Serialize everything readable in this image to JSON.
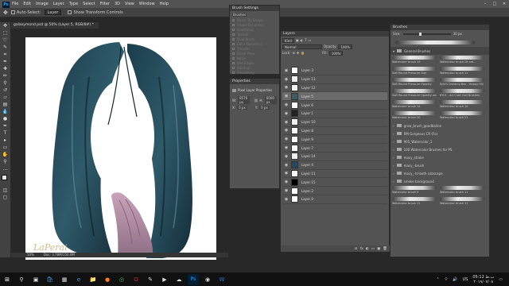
{
  "menubar": {
    "app_icon": "Ps",
    "items": [
      "File",
      "Edit",
      "Image",
      "Layer",
      "Type",
      "Select",
      "Filter",
      "3D",
      "View",
      "Window",
      "Help"
    ]
  },
  "window_controls": [
    "–",
    "□",
    "✕"
  ],
  "options_bar": {
    "auto_select": "Auto-Select:",
    "auto_select_target": "Layer",
    "show_transform": "Show Transform Controls"
  },
  "document": {
    "tab_title": "galaxymond.psd @ 50% (Layer 5, RGB/8#) *",
    "status": "50%",
    "doc_info": "Doc: 3.78M/150.0M",
    "signature": "LaPerai"
  },
  "brush_settings": {
    "title": "Brush Settings",
    "tab": "Brushes",
    "items": [
      "Brush Tip Shape",
      "Shape Dynamics",
      "Scattering",
      "Texture",
      "Dual Brush",
      "Color Dynamics",
      "Transfer",
      "Brush Pose",
      "Noise",
      "Wet Edges",
      "Build-up",
      "Smoothing"
    ]
  },
  "properties": {
    "title": "Properties",
    "subtitle": "Pixel Layer Properties",
    "w_label": "W:",
    "w_value": "8576 px",
    "h_label": "H:",
    "h_value": "6000 px",
    "x_label": "X:",
    "x_value": "0 px",
    "y_label": "Y:",
    "y_value": "0 px"
  },
  "layers": {
    "title": "Layers",
    "kind": "Kind",
    "mode": "Normal",
    "opacity_label": "Opacity:",
    "opacity": "100%",
    "lock_label": "Lock:",
    "fill_label": "Fill:",
    "fill": "100%",
    "items": [
      {
        "name": "Layer 3",
        "thumb": "#ffffff"
      },
      {
        "name": "Layer 13",
        "thumb": "#f0f0f0"
      },
      {
        "name": "Layer 12",
        "thumb": "#f3f3f3"
      },
      {
        "name": "Layer 5",
        "thumb": "#3d5d66",
        "selected": true
      },
      {
        "name": "Layer 6",
        "thumb": "#ffffff"
      },
      {
        "name": "Layer 1",
        "thumb": "#222222"
      },
      {
        "name": "Layer 10",
        "thumb": "#f2f2f2"
      },
      {
        "name": "Layer 8",
        "thumb": "#ffffff"
      },
      {
        "name": "Layer 9",
        "thumb": "#fafafa"
      },
      {
        "name": "Layer 7",
        "thumb": "#ffffff"
      },
      {
        "name": "Layer 14",
        "thumb": "#eeeeee"
      },
      {
        "name": "Layer 4",
        "thumb": "#1d4b66"
      },
      {
        "name": "Layer 11",
        "thumb": "#f5f5f5"
      },
      {
        "name": "Layer 15",
        "thumb": "#000000"
      },
      {
        "name": "Layer 2",
        "thumb": "#ffffff"
      },
      {
        "name": "Layer 0",
        "thumb": "#ffffff"
      }
    ],
    "footer_icons": [
      "⊘",
      "fx",
      "◐",
      "▭",
      "▣",
      "🗑"
    ]
  },
  "brushes": {
    "title": "Brushes",
    "size_label": "Size:",
    "size": "30 px",
    "group": "General Brushes",
    "grid": [
      [
        "Watercolor brush 19",
        "Watercolor brush 28 cat..."
      ],
      [
        "Soft Round Pressure Size",
        "Watercolor brush 11"
      ],
      [
        "Soft Round Pressure Opacity",
        "Kyle's Drawing Box - Happy Hill"
      ],
      [
        "Soft Round Pressure Opacity and Flow",
        "KYLE - Art Craft Gall Brushes"
      ],
      [
        "Watercolor brush 14",
        "Watercolor brush 10"
      ],
      [
        "Watercolor brush 20",
        "Watercolor brush 21"
      ]
    ],
    "folders": [
      "grow_brush_goodbaline",
      "RM Gorgeous CR (Fo)",
      "905_Watercolor_1",
      "100 Watercolor Brushes for PS",
      "macy_stroke",
      "macy_-brush",
      "macy_-hr-both cobscape",
      "smoke background"
    ],
    "bottom_grid": [
      [
        "Watercolor brush 9",
        "Watercolor brush 11"
      ],
      [
        "Watercolor brush 11",
        "Watercolor brush 11"
      ]
    ]
  },
  "taskbar": {
    "icons": [
      "start-icon",
      "search-icon",
      "task-view-icon",
      "store-icon",
      "calculator-icon",
      "edge-icon",
      "explorer-icon",
      "firefox-icon",
      "chrome-icon",
      "opera-icon",
      "paint-icon",
      "media-icon",
      "cloud-icon",
      "photoshop-icon",
      "camera-icon",
      "word-icon"
    ],
    "time": "05:12 ب.ظ",
    "date": "۲۰۱۹/۰۷/۰۸",
    "lang": "US"
  }
}
